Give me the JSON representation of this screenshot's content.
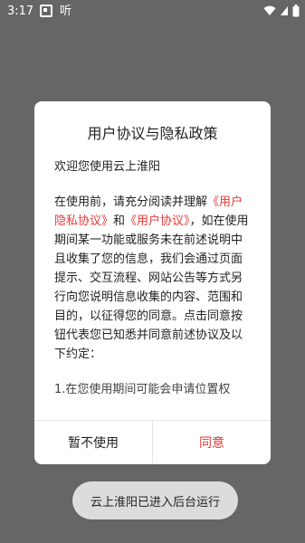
{
  "status_bar": {
    "time": "3:17",
    "notification_text": "听",
    "icons": [
      "wifi-icon",
      "signal-icon",
      "battery-icon"
    ]
  },
  "dialog": {
    "title": "用户协议与隐私政策",
    "welcome": "欢迎您使用云上淮阳",
    "paragraph_prefix": "在使用前，请充分阅读并理解",
    "link_1": "《用户隐私协议》",
    "and_text": "和",
    "link_2": "《用户协议》",
    "paragraph_suffix": "，如在使用期间某一功能或服务未在前述说明中且收集了您的信息，我们会通过页面提示、交互流程、网站公告等方式另行向您说明信息收集的内容、范围和目的，以征得您的同意。点击同意按钮代表您已知悉并同意前述协议及以下约定：",
    "truncated_line": "1.在您使用期间可能会申请位置权"
  },
  "buttons": {
    "decline": "暂不使用",
    "agree": "同意"
  },
  "toast": {
    "text": "云上淮阳已进入后台运行"
  },
  "colors": {
    "scrim": "#666666",
    "accent": "#e53935",
    "toast_bg": "#dcdcdc"
  }
}
